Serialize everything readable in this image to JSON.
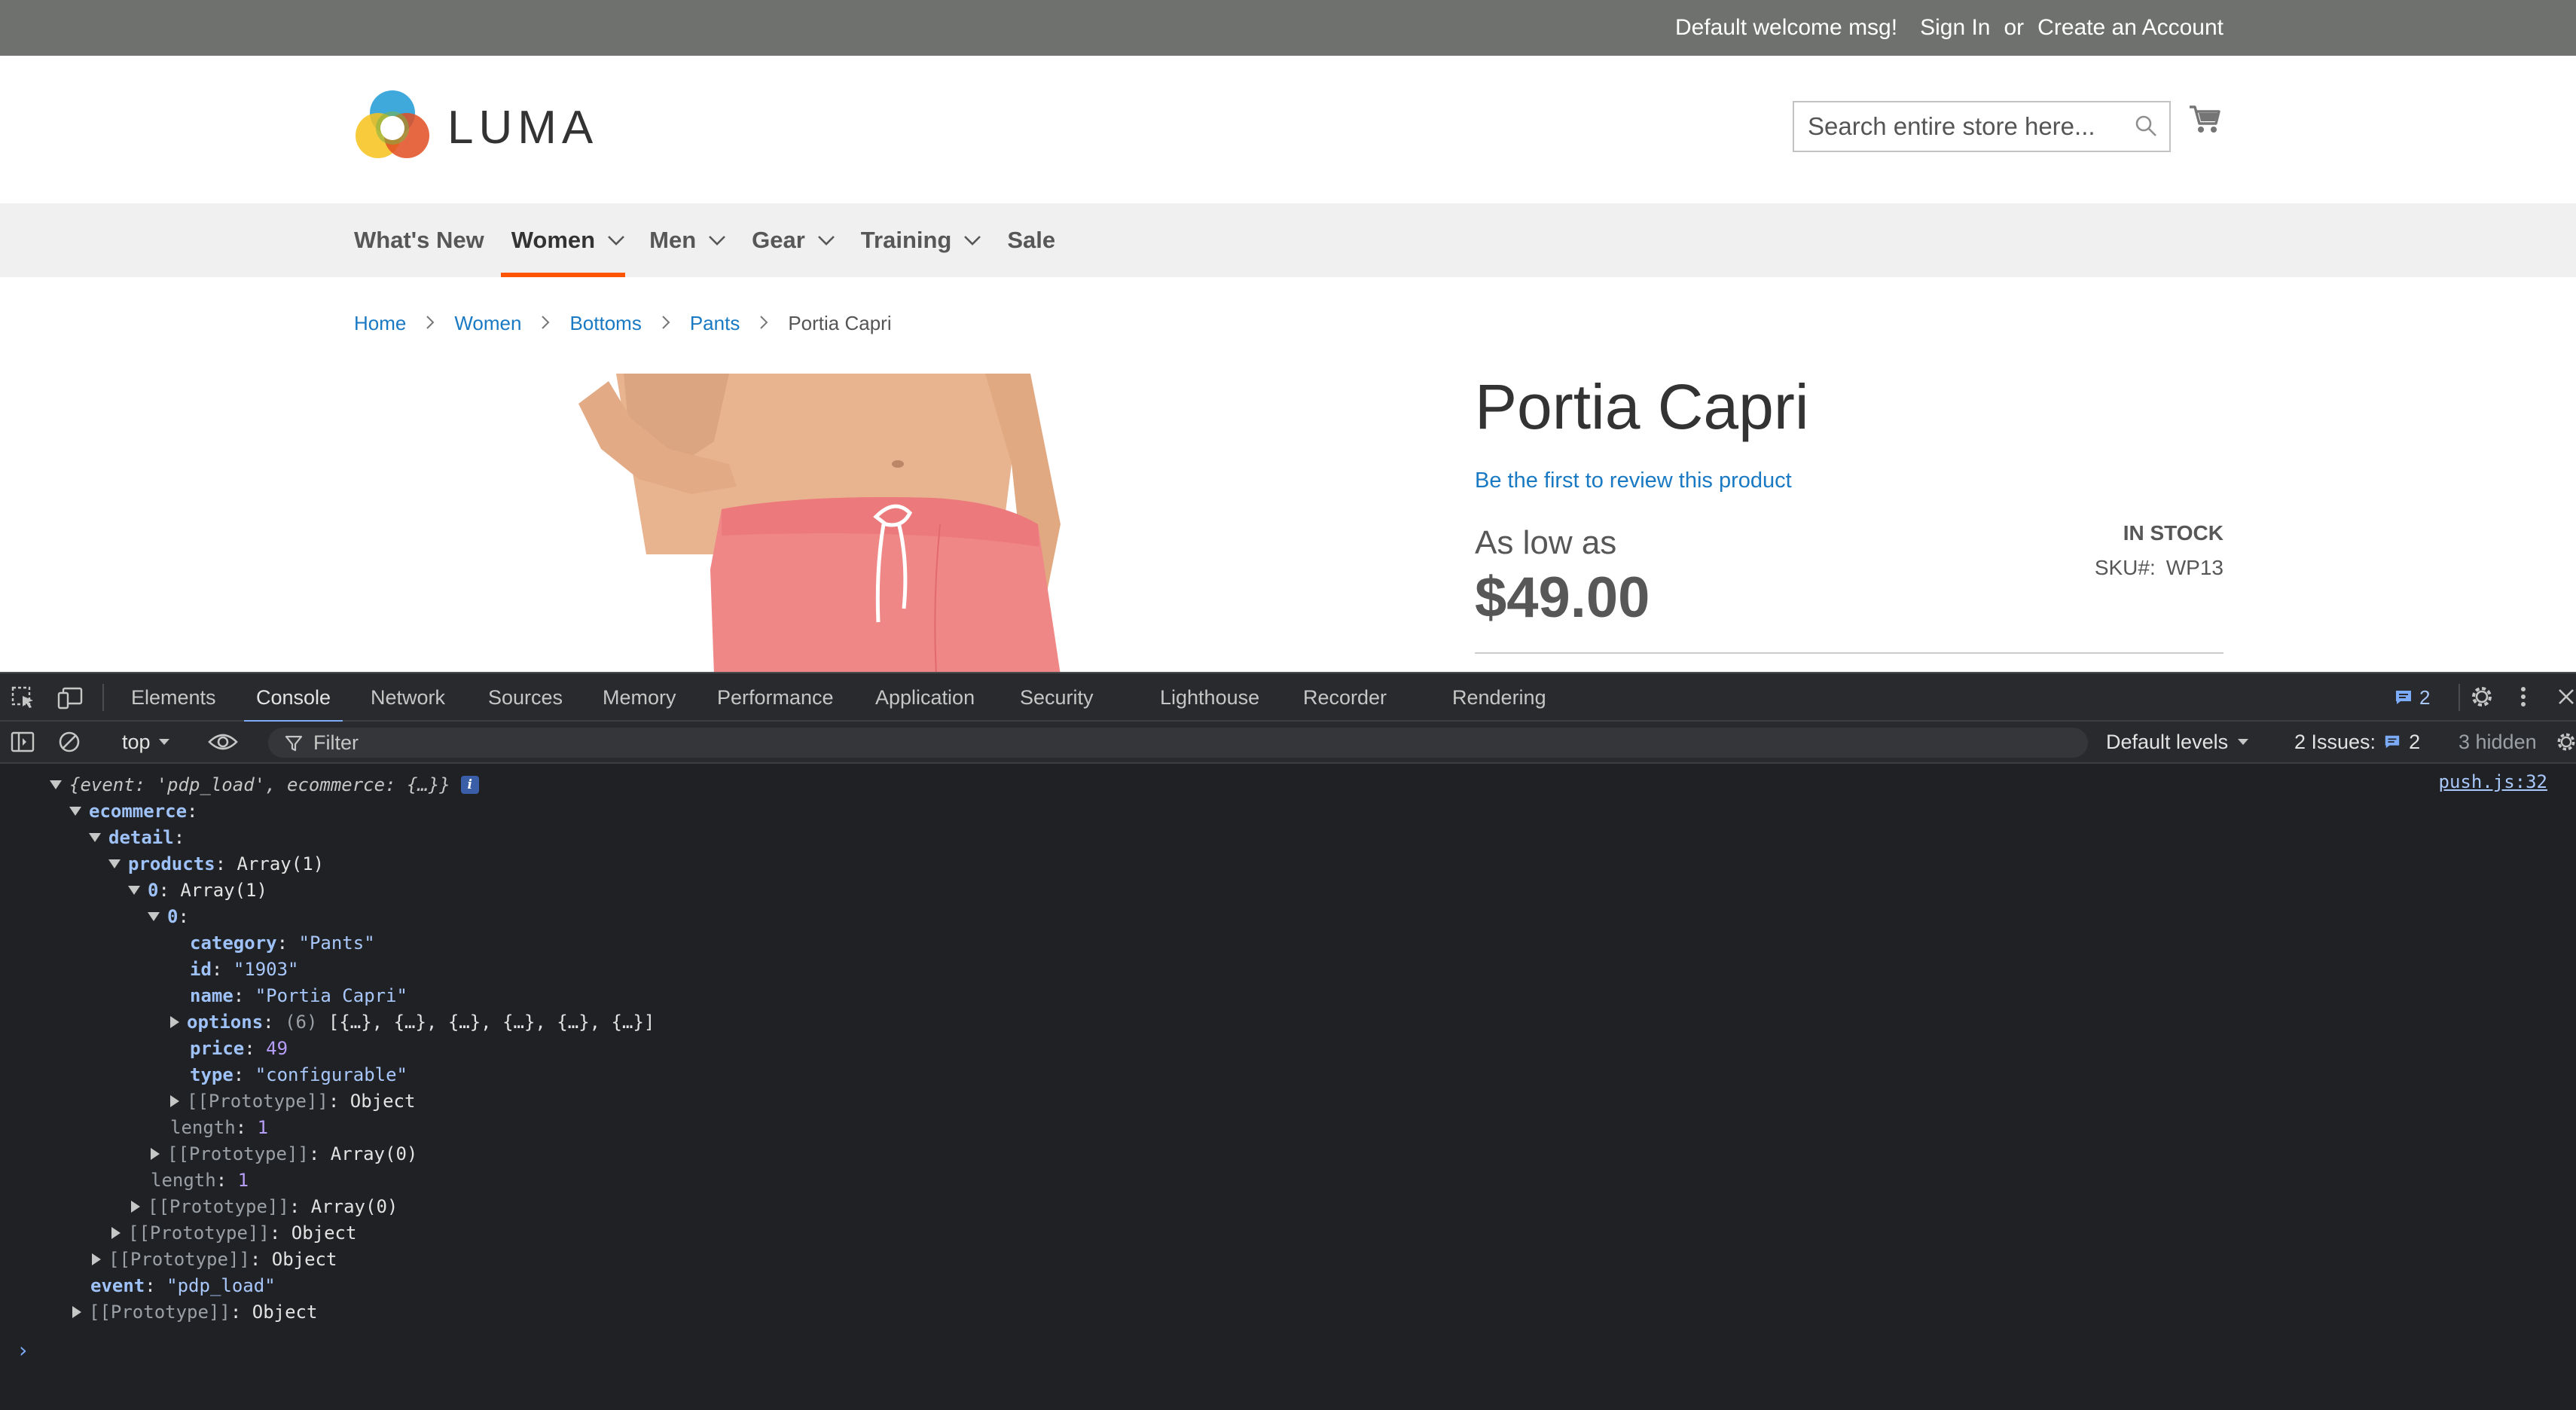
{
  "topbar": {
    "welcome": "Default welcome msg!",
    "sign_in": "Sign In",
    "or": "or",
    "create_account": "Create an Account"
  },
  "header": {
    "logo_text": "LUMA",
    "search_placeholder": "Search entire store here..."
  },
  "nav": {
    "items": [
      {
        "label": "What's New",
        "has_dropdown": false,
        "active": false
      },
      {
        "label": "Women",
        "has_dropdown": true,
        "active": true
      },
      {
        "label": "Men",
        "has_dropdown": true,
        "active": false
      },
      {
        "label": "Gear",
        "has_dropdown": true,
        "active": false
      },
      {
        "label": "Training",
        "has_dropdown": true,
        "active": false
      },
      {
        "label": "Sale",
        "has_dropdown": false,
        "active": false
      }
    ],
    "accent_color": "#ff5501"
  },
  "breadcrumbs": {
    "items": [
      "Home",
      "Women",
      "Bottoms",
      "Pants"
    ],
    "current": "Portia Capri"
  },
  "product": {
    "title": "Portia Capri",
    "review_link": "Be the first to review this product",
    "as_low_as": "As low as",
    "price": "$49.00",
    "stock": "IN STOCK",
    "sku_label": "SKU#:",
    "sku_value": "WP13"
  },
  "devtools": {
    "tabs": [
      "Elements",
      "Console",
      "Network",
      "Sources",
      "Memory",
      "Performance",
      "Application",
      "Security",
      "Lighthouse",
      "Recorder",
      "Rendering"
    ],
    "active_tab": "Console",
    "messages_count": "2",
    "context": "top",
    "filter_placeholder": "Filter",
    "levels": "Default levels",
    "issues_label": "2 Issues:",
    "issues_count": "2",
    "hidden": "3 hidden",
    "source_link": "push.js:32"
  },
  "console_log": {
    "summary_event_key": "event",
    "summary_event_val": "'pdp_load'",
    "summary_ecom_key": "ecommerce",
    "summary_ecom_val": "{…}",
    "ecommerce": "ecommerce",
    "detail": "detail",
    "products": "products",
    "products_val": "Array(1)",
    "idx0": "0",
    "idx0_val": "Array(1)",
    "inner0": "0",
    "category_key": "category",
    "category_val": "\"Pants\"",
    "id_key": "id",
    "id_val": "\"1903\"",
    "name_key": "name",
    "name_val": "\"Portia Capri\"",
    "options_key": "options",
    "options_count": "(6)",
    "options_val": "[{…}, {…}, {…}, {…}, {…}, {…}]",
    "price_key": "price",
    "price_val": "49",
    "type_key": "type",
    "type_val": "\"configurable\"",
    "proto_key": "[[Prototype]]",
    "proto_object": "Object",
    "proto_array0": "Array(0)",
    "length_key": "length",
    "length_val": "1",
    "event_key": "event",
    "event_val": "\"pdp_load\""
  }
}
